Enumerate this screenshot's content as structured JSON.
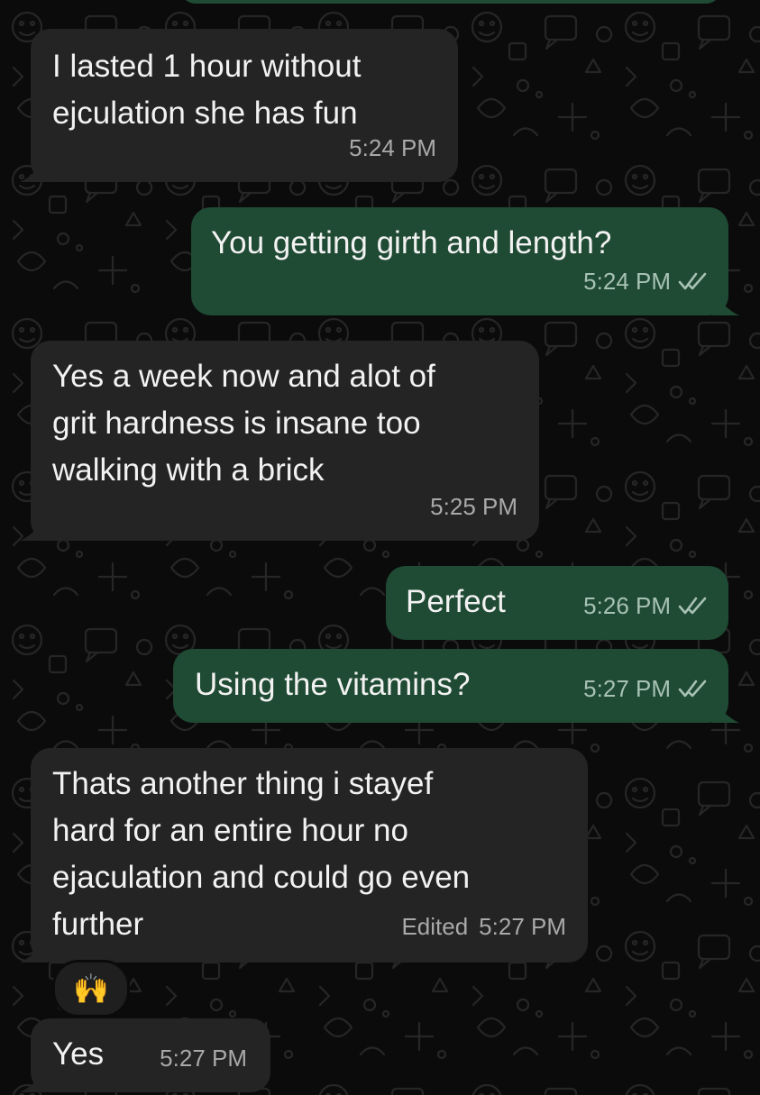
{
  "conversation": {
    "messages": [
      {
        "direction": "incoming",
        "text": "I lasted 1 hour without\nejculation she has fun",
        "time": "5:24 PM"
      },
      {
        "direction": "outgoing",
        "text": "You getting girth and length?",
        "time": "5:24 PM",
        "status": "read"
      },
      {
        "direction": "incoming",
        "text": "Yes a week now and alot of\ngrit hardness is insane too\nwalking with a brick",
        "time": "5:25 PM"
      },
      {
        "direction": "outgoing",
        "text": "Perfect",
        "time": "5:26 PM",
        "status": "read"
      },
      {
        "direction": "outgoing",
        "text": "Using the vitamins?",
        "time": "5:27 PM",
        "status": "read"
      },
      {
        "direction": "incoming",
        "text": "Thats another thing i stayef\nhard for an entire hour no\nejaculation and could go even\nfurther",
        "time": "5:27 PM",
        "edited_label": "Edited",
        "reaction": "🙌"
      },
      {
        "direction": "incoming",
        "text": "Yes",
        "time": "5:27 PM"
      }
    ]
  },
  "theme": {
    "background": "#0b0b0b",
    "incoming_bubble": "#242424",
    "outgoing_bubble": "#1f4a33",
    "tick_color": "#a7c2b2"
  },
  "icons": {
    "read_receipt": "double-check-icon",
    "wallpaper": "doodle-pattern"
  }
}
